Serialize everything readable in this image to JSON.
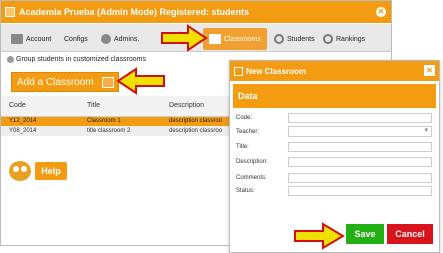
{
  "window": {
    "title": "Academia Prueba (Admin Mode) Registered: students"
  },
  "tabs": [
    {
      "label": "Account",
      "icon": "folder-icon"
    },
    {
      "label": "Configs",
      "icon": "gear-icon"
    },
    {
      "label": "Admins.",
      "icon": "user-icon"
    },
    {
      "label": "Classrooms",
      "icon": "classroom-icon"
    },
    {
      "label": "Students",
      "icon": "search-icon"
    },
    {
      "label": "Rankings",
      "icon": "search-icon"
    }
  ],
  "group": {
    "label": "Group students in customized classrooms"
  },
  "add_button": {
    "label": "Add a Classroom"
  },
  "table": {
    "headers": [
      "Code",
      "Title",
      "Description"
    ],
    "rows": [
      [
        "Y12_2014",
        "Classroom 1",
        "description classroo"
      ],
      [
        "Y08_2014",
        "title classroom 2",
        "description classroo"
      ]
    ]
  },
  "help": {
    "label": "Help"
  },
  "modal": {
    "title": "New Classroom",
    "section": "Data",
    "fields": [
      "Code:",
      "Teacher:",
      "Title:",
      "Description:",
      "Comments:",
      "Status:"
    ],
    "save": "Save",
    "cancel": "Cancel"
  },
  "colors": {
    "accent": "#f39c12",
    "save": "#22b014",
    "cancel": "#d8141c",
    "arrow": "#f0e000"
  }
}
